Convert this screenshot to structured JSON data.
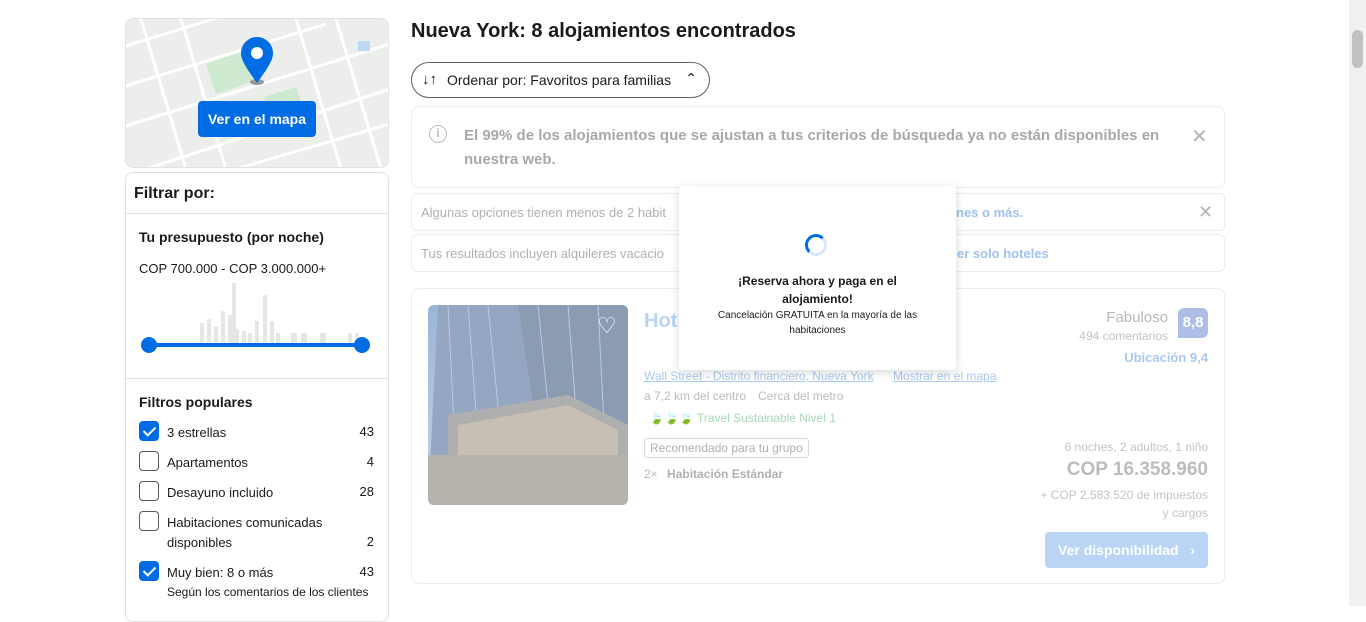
{
  "map": {
    "button_label": "Ver en el mapa"
  },
  "filters": {
    "title": "Filtrar por:",
    "budget": {
      "title": "Tu presupuesto (por noche)",
      "range": "COP 700.000 - COP 3.000.000+"
    },
    "popular": {
      "title": "Filtros populares",
      "items": [
        {
          "label": "3 estrellas",
          "count": "43",
          "checked": true
        },
        {
          "label": "Apartamentos",
          "count": "4",
          "checked": false
        },
        {
          "label": "Desayuno incluido",
          "count": "28",
          "checked": false
        },
        {
          "label": "Habitaciones comunicadas disponibles",
          "count": "2",
          "checked": false
        },
        {
          "label": "Muy bien: 8 o más",
          "count": "43",
          "checked": true,
          "sub": "Según los comentarios de los clientes"
        }
      ]
    }
  },
  "header": {
    "title": "Nueva York: 8 alojamientos encontrados",
    "sort_label": "Ordenar por: Favoritos para familias"
  },
  "notices": {
    "info": "El 99% de los alojamientos que se ajustan a tus criterios de búsqueda ya no están disponibles en nuestra web.",
    "rooms_text": "Algunas opciones tienen menos de 2 habit",
    "rooms_link": "nes o más.",
    "rentals_text": "Tus resultados incluyen alquileres vacacio",
    "rentals_link": "er solo hoteles"
  },
  "property": {
    "name": "Hot                                      ct, an IHG Hot",
    "location": "Wall Street - Distrito financiero, Nueva York",
    "map_link": "Mostrar en el mapa",
    "distance": "a 7,2 km del centro",
    "metro": "Cerca del metro",
    "sustainable": "Travel Sustainable Nivel 1",
    "tag": "Recomendado para tu grupo",
    "room_qty": "2×",
    "room_type": "Habitación Estándar",
    "score_word": "Fabuloso",
    "reviews": "494 comentarios",
    "score": "8,8",
    "location_score": "Ubicación 9,4",
    "stay": "6 noches, 2 adultos, 1 niño",
    "price": "COP 16.358.960",
    "taxes": "+ COP 2.583.520 de impuestos y cargos",
    "cta": "Ver disponibilidad"
  },
  "popup": {
    "title": "¡Reserva ahora y paga en el alojamiento!",
    "subtitle": "Cancelación GRATUITA en la mayoría de las habitaciones"
  },
  "colors": {
    "accent": "#006ce4",
    "score_bg": "#003b95"
  }
}
